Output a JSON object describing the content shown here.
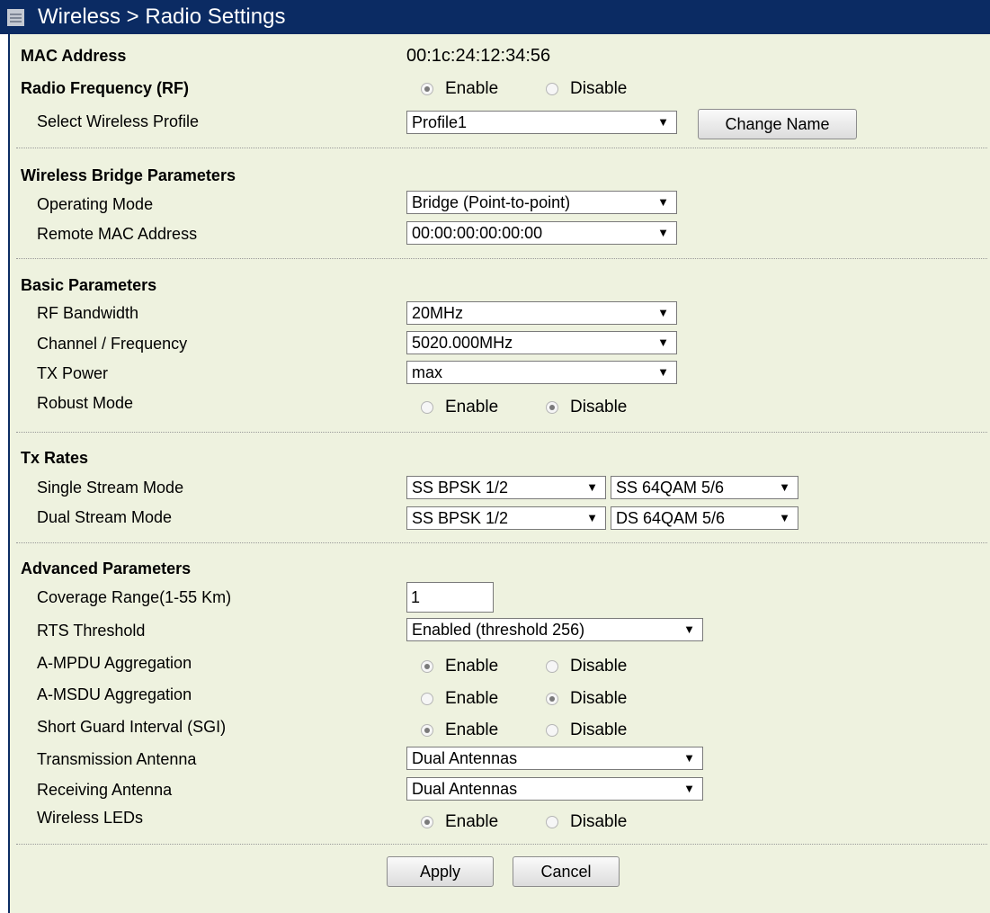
{
  "header": {
    "title": "Wireless > Radio Settings",
    "icon": "menu-icon"
  },
  "mac": {
    "label": "MAC Address",
    "value": "00:1c:24:12:34:56"
  },
  "rf": {
    "label": "Radio Frequency (RF)",
    "enable": "Enable",
    "disable": "Disable",
    "selected": "Enable"
  },
  "profile": {
    "label": "Select Wireless Profile",
    "value": "Profile1",
    "button": "Change Name"
  },
  "bridge": {
    "title": "Wireless Bridge Parameters",
    "operating_mode_label": "Operating Mode",
    "operating_mode_value": "Bridge (Point-to-point)",
    "remote_mac_label": "Remote MAC Address",
    "remote_mac_value": "00:00:00:00:00:00"
  },
  "basic": {
    "title": "Basic Parameters",
    "bandwidth_label": "RF Bandwidth",
    "bandwidth_value": "20MHz",
    "channel_label": "Channel / Frequency",
    "channel_value": "5020.000MHz",
    "txpower_label": "TX Power",
    "txpower_value": "max",
    "robust_label": "Robust Mode",
    "robust_enable": "Enable",
    "robust_disable": "Disable",
    "robust_selected": "Disable"
  },
  "tx": {
    "title": "Tx Rates",
    "single_label": "Single Stream Mode",
    "single_from": "SS BPSK 1/2",
    "single_to": "SS 64QAM 5/6",
    "dual_label": "Dual Stream Mode",
    "dual_from": "SS BPSK 1/2",
    "dual_to": "DS 64QAM 5/6",
    "dash": "-"
  },
  "advanced": {
    "title": "Advanced Parameters",
    "coverage_label": "Coverage Range(1-55 Km)",
    "coverage_value": "1",
    "rts_label": "RTS Threshold",
    "rts_value": "Enabled (threshold 256)",
    "ampdu_label": "A-MPDU Aggregation",
    "ampdu_selected": "Enable",
    "amsdu_label": "A-MSDU Aggregation",
    "amsdu_selected": "Disable",
    "sgi_label": "Short Guard Interval (SGI)",
    "sgi_selected": "Enable",
    "tx_antenna_label": "Transmission Antenna",
    "tx_antenna_value": "Dual Antennas",
    "rx_antenna_label": "Receiving Antenna",
    "rx_antenna_value": "Dual Antennas",
    "leds_label": "Wireless LEDs",
    "leds_selected": "Enable",
    "enable": "Enable",
    "disable": "Disable"
  },
  "actions": {
    "apply": "Apply",
    "cancel": "Cancel"
  }
}
